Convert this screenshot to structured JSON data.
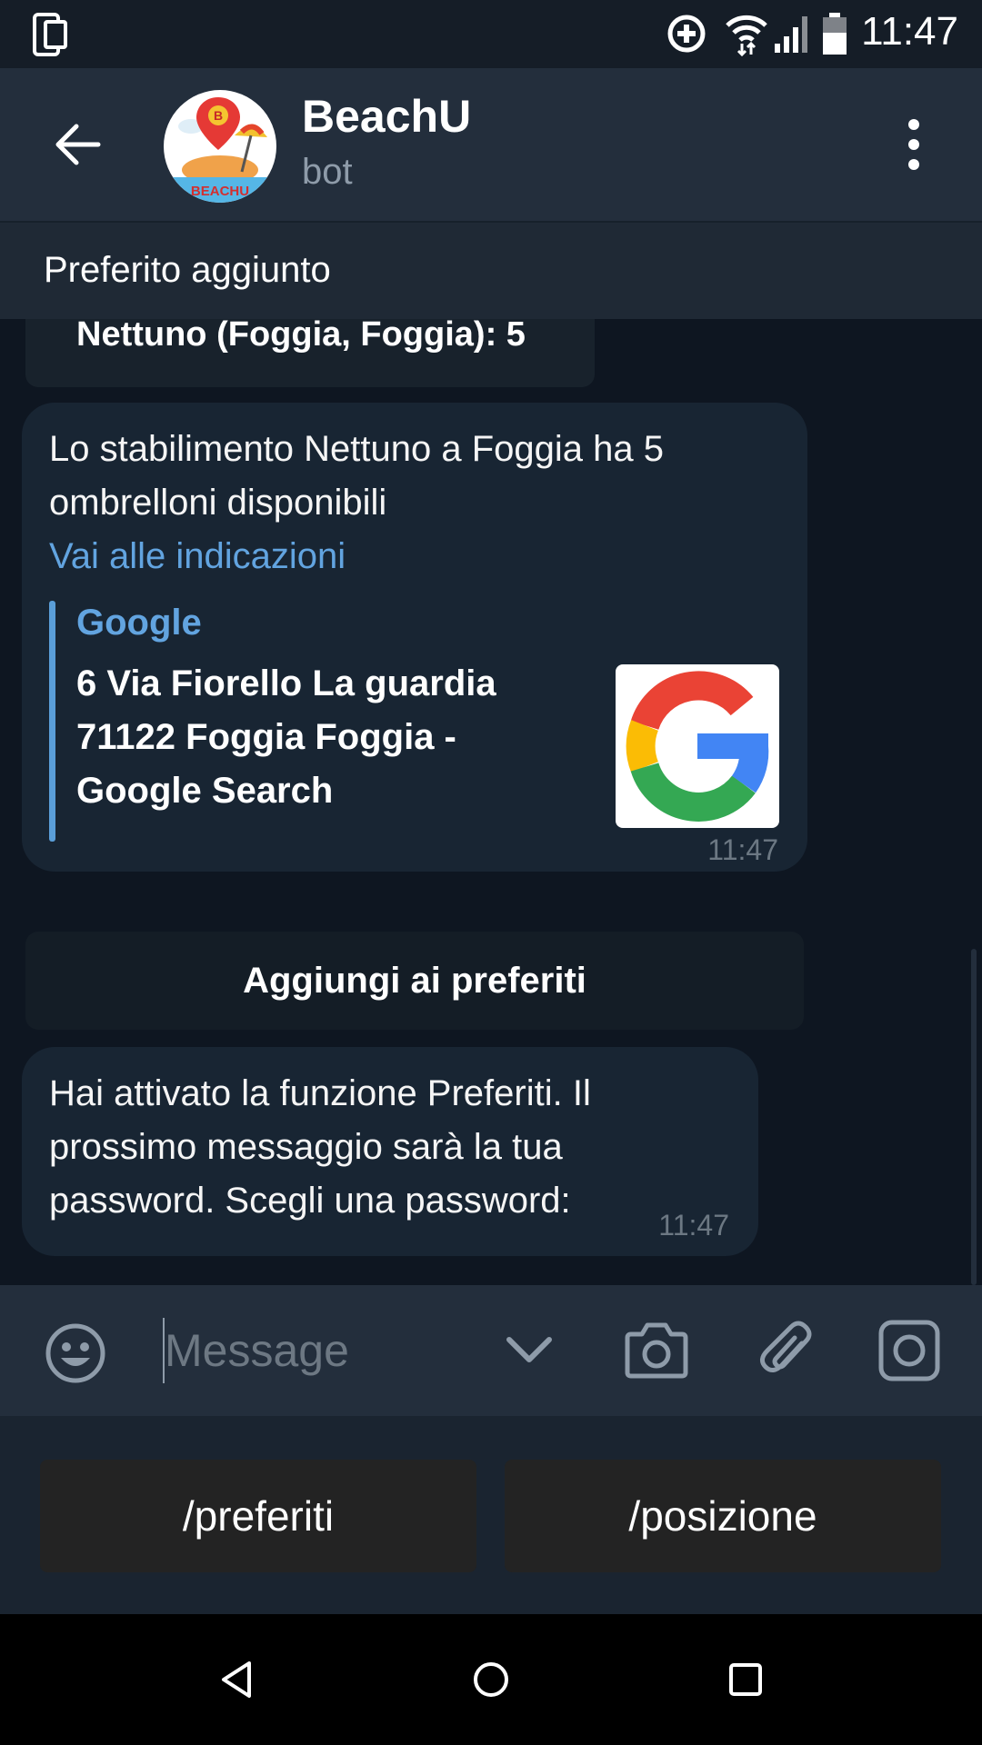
{
  "status_bar": {
    "time": "11:47",
    "icons": [
      "phone-device-icon",
      "data-saver-icon",
      "wifi-icon",
      "signal-icon",
      "battery-icon"
    ]
  },
  "header": {
    "title": "BeachU",
    "subtitle": "bot",
    "avatar_text": "BEACHU"
  },
  "pinned": {
    "text": "Preferito aggiunto"
  },
  "chat": {
    "previous_button_label": "Nettuno (Foggia, Foggia): 5",
    "message_1": {
      "text": "Lo stabilimento Nettuno a Foggia ha 5 ombrelloni disponibili",
      "link": "Vai alle indicazioni",
      "preview": {
        "site": "Google",
        "title": "6 Via Fiorello La guardia 71122 Foggia Foggia - Google Search"
      },
      "time": "11:47"
    },
    "inline_button_label": "Aggiungi ai preferiti",
    "message_2": {
      "text": "Hai attivato la funzione Preferiti. Il prossimo messaggio sarà la tua password. Scegli una password:",
      "time": "11:47"
    }
  },
  "input_bar": {
    "placeholder": "Message"
  },
  "bot_keyboard": {
    "buttons": [
      "/preferiti",
      "/posizione"
    ]
  },
  "colors": {
    "header_bg": "#232e3c",
    "chat_bg": "#0e1621",
    "bubble_bg": "#182533",
    "link": "#62a4e0",
    "muted": "#8e9ba9"
  }
}
